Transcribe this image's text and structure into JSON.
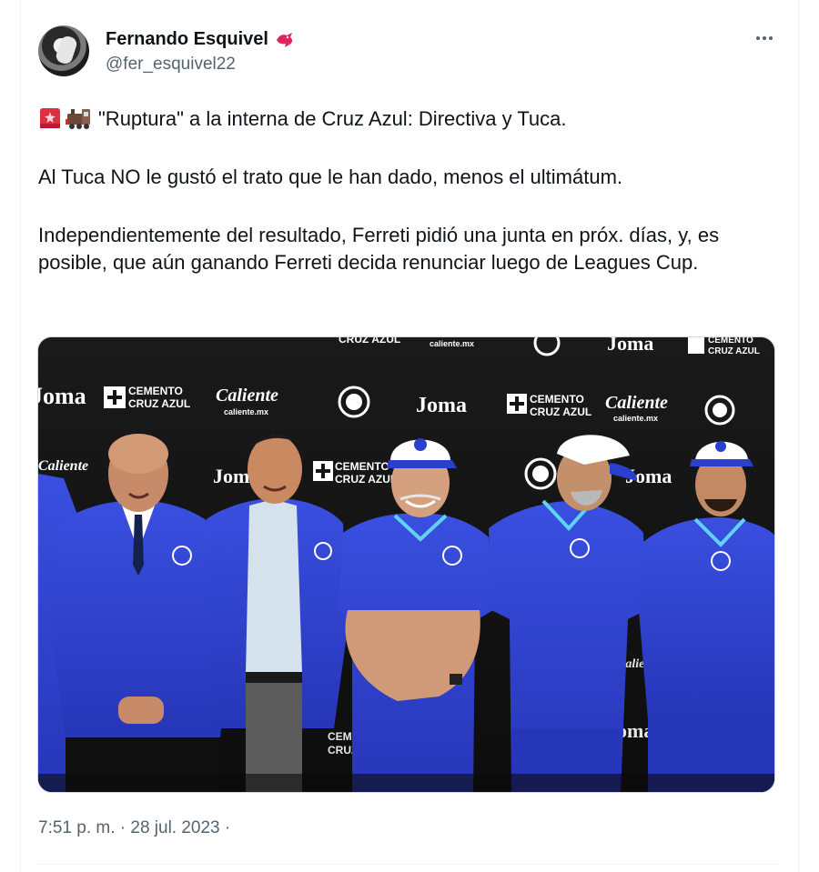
{
  "author": {
    "name": "Fernando Esquivel",
    "handle": "@fer_esquivel22",
    "badge_icon": "red-bird-icon"
  },
  "tweet": {
    "line1": "\"Ruptura\" a la interna de Cruz Azul: Directiva y Tuca.",
    "line2": "Al Tuca NO le gustó el trato que le han dado, menos el ultimátum.",
    "line3": "Independientemente del resultado, Ferreti pidió una junta en próx. días, y, es posible, que aún ganando Ferreti decida renunciar luego de Leagues Cup.",
    "emojis": [
      "rotating-light-icon",
      "steam-locomotive-icon"
    ]
  },
  "media": {
    "banner": {
      "joma": "Joma",
      "cemento_1": "CEMENTO",
      "cemento_2": "CRUZ AZUL",
      "caliente": "Caliente",
      "caliente_url": "caliente.mx"
    }
  },
  "meta": {
    "timestamp": "7:51 p. m. · 28 jul. 2023 ·"
  },
  "colors": {
    "text": "#0f1419",
    "secondary": "#536471",
    "jersey_blue": "#2b3fcf",
    "badge_red": "#e0245e"
  }
}
